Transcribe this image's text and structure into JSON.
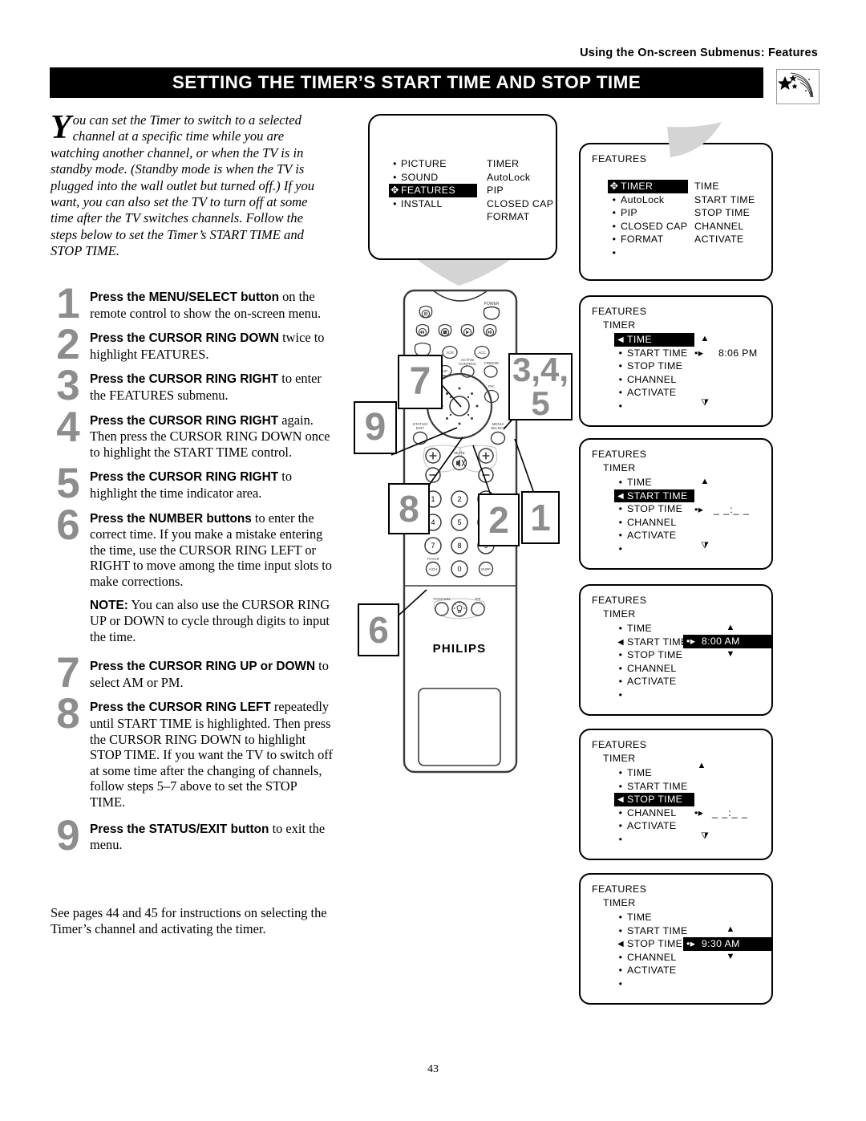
{
  "running_head": "Using the On-screen Submenus: Features",
  "title": "SETTING THE TIMER’S START TIME AND STOP TIME",
  "badge_icon": "shooting-stars-icon",
  "page_number": "43",
  "lead": {
    "dropcap": "Y",
    "text": "ou can set the Timer to switch to a selected channel at a specific time while you are watching another channel, or when the TV is in standby mode. (Standby mode is when the TV is plugged into the wall outlet but turned off.) If you want, you can also set the TV to turn off at some time after the TV switches channels. Follow the steps below to set the Timer’s START TIME and STOP TIME."
  },
  "steps": [
    {
      "num": "1",
      "bold": "Press the MENU/SELECT button",
      "rest": " on the remote control to show the on-screen menu."
    },
    {
      "num": "2",
      "bold": "Press the CURSOR RING DOWN",
      "rest": " twice to highlight FEATURES."
    },
    {
      "num": "3",
      "bold": "Press the CURSOR RING RIGHT",
      "rest": " to enter the FEATURES submenu."
    },
    {
      "num": "4",
      "bold": "Press the CURSOR RING RIGHT",
      "rest": " again. Then press the CURSOR RING DOWN once to highlight the START TIME control."
    },
    {
      "num": "5",
      "bold": "Press the CURSOR RING RIGHT",
      "rest": " to highlight the time indicator area."
    },
    {
      "num": "6",
      "bold": "Press the NUMBER buttons",
      "rest": " to enter the correct time. If you make a mistake entering the time, use the CURSOR RING LEFT or RIGHT to move among the time input slots to make corrections."
    },
    {
      "num": "7",
      "bold": "Press the CURSOR RING UP or DOWN",
      "rest": " to select AM or PM."
    },
    {
      "num": "8",
      "bold": "Press the CURSOR RING LEFT",
      "rest": " repeatedly until START TIME is highlighted. Then press the CURSOR RING DOWN to highlight STOP TIME. If you want the TV to switch off at some time after the changing of channels, follow steps 5–7 above to set the STOP TIME."
    },
    {
      "num": "9",
      "bold": "Press the STATUS/EXIT button",
      "rest": " to exit the menu."
    }
  ],
  "note": {
    "bold": "NOTE:",
    "rest": " You can also use the CURSOR RING UP or DOWN to cycle through digits to input the time."
  },
  "closing": "See pages 44 and 45 for instructions on selecting the Timer’s channel and activating the timer.",
  "tv_screen": {
    "left_items": [
      {
        "label": "PICTURE",
        "highlighted": false
      },
      {
        "label": "SOUND",
        "highlighted": false
      },
      {
        "label": "FEATURES",
        "highlighted": true
      },
      {
        "label": "INSTALL",
        "highlighted": false
      }
    ],
    "right_items": [
      "TIMER",
      "AutoLock",
      "PIP",
      "CLOSED CAP",
      "FORMAT"
    ]
  },
  "panels": [
    {
      "title": "FEATURES",
      "sub": "",
      "items": [
        {
          "label": "TIMER",
          "highlighted": true
        },
        {
          "label": "AutoLock",
          "highlighted": false
        },
        {
          "label": "PIP",
          "highlighted": false
        },
        {
          "label": "CLOSED CAP",
          "highlighted": false
        },
        {
          "label": "FORMAT",
          "highlighted": false
        },
        {
          "label": "",
          "highlighted": false
        }
      ],
      "values": [
        "TIME",
        "START TIME",
        "STOP TIME",
        "CHANNEL",
        "ACTIVATE"
      ],
      "value_index": -1,
      "value_text": "",
      "value_highlighted": false,
      "arrow_up": false,
      "arrow_down": false
    },
    {
      "title": "FEATURES",
      "sub": "TIMER",
      "items": [
        {
          "label": "TIME",
          "highlighted": true
        },
        {
          "label": "START TIME",
          "highlighted": false
        },
        {
          "label": "STOP TIME",
          "highlighted": false
        },
        {
          "label": "CHANNEL",
          "highlighted": false
        },
        {
          "label": "ACTIVATE",
          "highlighted": false
        },
        {
          "label": "",
          "highlighted": false
        }
      ],
      "values": [],
      "value_index": 0,
      "value_text": "8:06 PM",
      "value_highlighted": false,
      "arrow_up": true,
      "arrow_down": true
    },
    {
      "title": "FEATURES",
      "sub": "TIMER",
      "items": [
        {
          "label": "TIME",
          "highlighted": false
        },
        {
          "label": "START TIME",
          "highlighted": true
        },
        {
          "label": "STOP TIME",
          "highlighted": false
        },
        {
          "label": "CHANNEL",
          "highlighted": false
        },
        {
          "label": "ACTIVATE",
          "highlighted": false
        },
        {
          "label": "",
          "highlighted": false
        }
      ],
      "values": [],
      "value_index": 1,
      "value_text": "_ _:_ _",
      "value_highlighted": false,
      "arrow_up": true,
      "arrow_down": true
    },
    {
      "title": "FEATURES",
      "sub": "TIMER",
      "items": [
        {
          "label": "TIME",
          "highlighted": false
        },
        {
          "label": "START TIME",
          "highlighted": false,
          "arrowleft": true
        },
        {
          "label": "STOP TIME",
          "highlighted": false
        },
        {
          "label": "CHANNEL",
          "highlighted": false
        },
        {
          "label": "ACTIVATE",
          "highlighted": false
        },
        {
          "label": "",
          "highlighted": false
        }
      ],
      "values": [],
      "value_index": 1,
      "value_text": "8:00 AM",
      "value_highlighted": true,
      "arrow_up": true,
      "arrow_down": true
    },
    {
      "title": "FEATURES",
      "sub": "TIMER",
      "items": [
        {
          "label": "TIME",
          "highlighted": false
        },
        {
          "label": "START TIME",
          "highlighted": false
        },
        {
          "label": "STOP TIME",
          "highlighted": true
        },
        {
          "label": "CHANNEL",
          "highlighted": false
        },
        {
          "label": "ACTIVATE",
          "highlighted": false
        },
        {
          "label": "",
          "highlighted": false
        }
      ],
      "values": [],
      "value_index": 2,
      "value_text": "_ _:_ _",
      "value_highlighted": false,
      "arrow_up": true,
      "arrow_down": true
    },
    {
      "title": "FEATURES",
      "sub": "TIMER",
      "items": [
        {
          "label": "TIME",
          "highlighted": false
        },
        {
          "label": "START TIME",
          "highlighted": false
        },
        {
          "label": "STOP TIME",
          "highlighted": false,
          "arrowleft": true
        },
        {
          "label": "CHANNEL",
          "highlighted": false
        },
        {
          "label": "ACTIVATE",
          "highlighted": false
        },
        {
          "label": "",
          "highlighted": false
        }
      ],
      "values": [],
      "value_index": 2,
      "value_text": "9:30 AM",
      "value_highlighted": true,
      "arrow_up": true,
      "arrow_down": true
    }
  ],
  "remote": {
    "brand": "PHILIPS",
    "labels": {
      "power": "POWER",
      "vcr": "VCR",
      "acc": "ACC",
      "active_control": "ACTIVE CONTROL",
      "freeze": "FREEZE",
      "pipch": "PIP CH",
      "dn": "DN",
      "up": "UP",
      "sound": "SOUND",
      "pic": "PIC",
      "status_exit": "STATUS/ EXIT",
      "menu_select": "MENU/ SELECT",
      "mute": "MUTE",
      "tvvcr": "TV/VCR",
      "ach": "A/CH",
      "surf": "SURF",
      "position": "POSITION",
      "pip": "PIP"
    },
    "keypad": [
      "1",
      "2",
      "3",
      "4",
      "5",
      "6",
      "7",
      "8",
      "9",
      "0"
    ]
  },
  "callouts": [
    {
      "id": "callout-1",
      "text": "1"
    },
    {
      "id": "callout-2",
      "text": "2"
    },
    {
      "id": "callout-345",
      "line1": "3,4,",
      "line2": "5"
    },
    {
      "id": "callout-6",
      "text": "6"
    },
    {
      "id": "callout-7",
      "text": "7"
    },
    {
      "id": "callout-8",
      "text": "8"
    },
    {
      "id": "callout-9",
      "text": "9"
    }
  ]
}
